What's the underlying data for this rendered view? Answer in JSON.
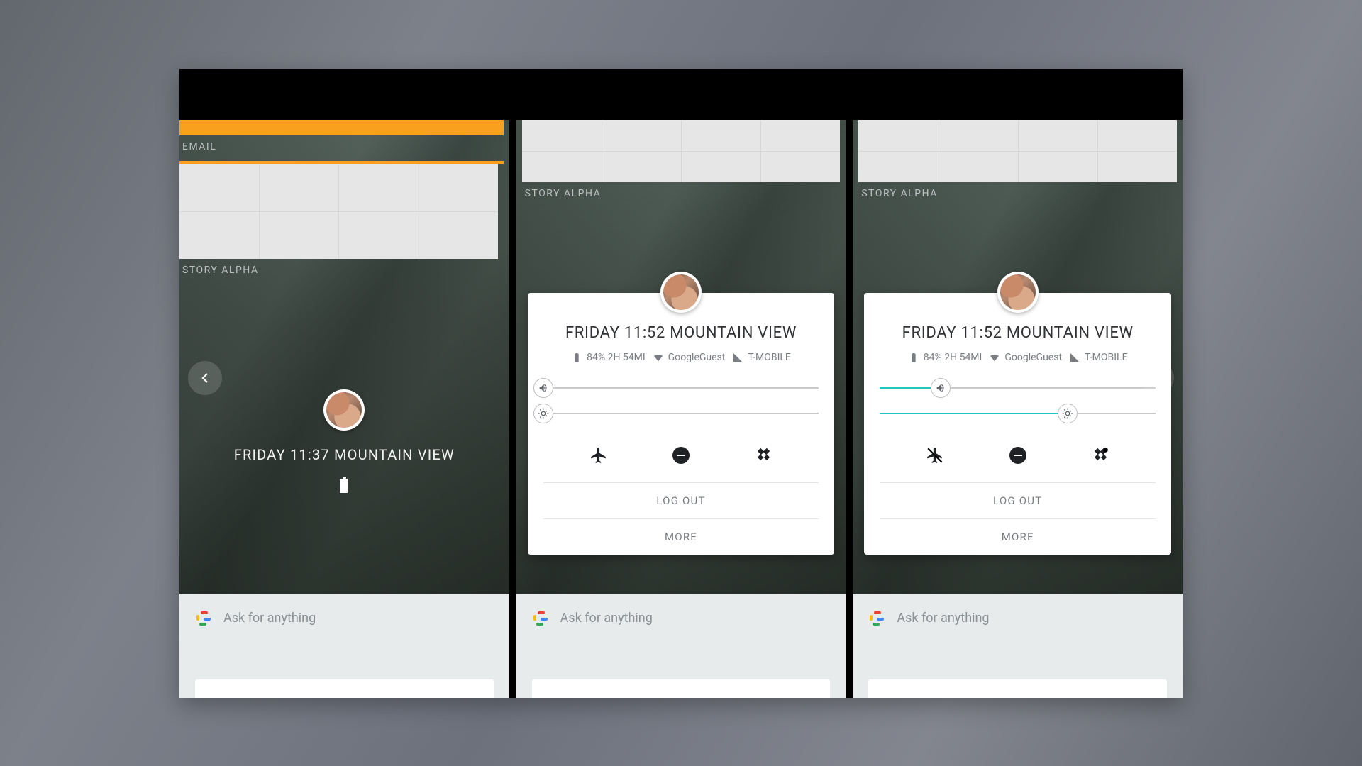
{
  "panels": {
    "left": {
      "widgets": [
        {
          "label": "EMAIL"
        },
        {
          "label": "STORY ALPHA"
        }
      ],
      "datetime": "FRIDAY 11:37 MOUNTAIN VIEW"
    },
    "middle": {
      "widget_label": "STORY ALPHA",
      "datetime": "FRIDAY 11:52 MOUNTAIN VIEW",
      "battery": "84% 2H 54MI",
      "wifi": "GoogleGuest",
      "cell": "T-MOBILE",
      "volume_pct": 0,
      "brightness_pct": 0,
      "airplane_on": false,
      "rotation_locked": false,
      "logout_label": "LOG OUT",
      "more_label": "MORE"
    },
    "right": {
      "widget_label": "STORY ALPHA",
      "datetime": "FRIDAY 11:52 MOUNTAIN VIEW",
      "battery": "84% 2H 54MI",
      "wifi": "GoogleGuest",
      "cell": "T-MOBILE",
      "volume_pct": 22,
      "brightness_pct": 68,
      "airplane_on": true,
      "rotation_locked": true,
      "logout_label": "LOG OUT",
      "more_label": "MORE"
    }
  },
  "search_placeholder": "Ask for anything",
  "accent_color": "#22c6bd"
}
